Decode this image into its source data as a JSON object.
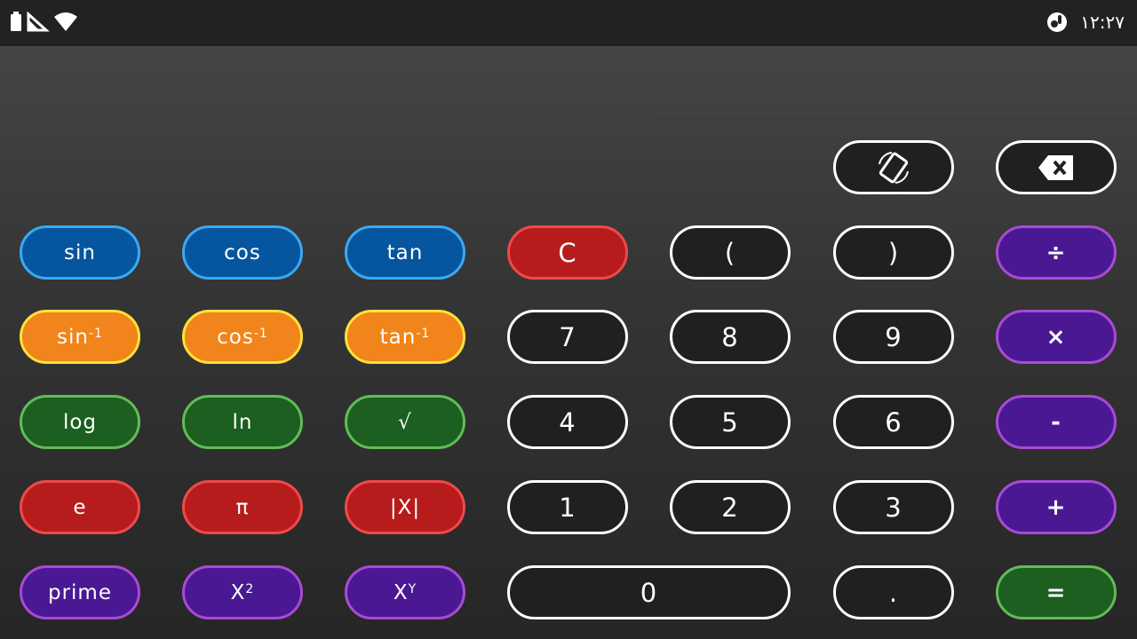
{
  "status_bar": {
    "time": "۱۲:۲۷",
    "icons": [
      "battery-icon",
      "signal-icon",
      "wifi-icon",
      "app-notification-icon"
    ]
  },
  "keys": {
    "rotate_icon": "screen-rotation-icon",
    "backspace_icon": "backspace-icon",
    "sin": "sin",
    "cos": "cos",
    "tan": "tan",
    "clear": "C",
    "paren_open": "(",
    "paren_close": ")",
    "divide": "÷",
    "asin_base": "sin",
    "acos_base": "cos",
    "atan_base": "tan",
    "inverse_exp": "-1",
    "seven": "7",
    "eight": "8",
    "nine": "9",
    "multiply": "×",
    "log": "log",
    "ln": "ln",
    "sqrt": "√",
    "four": "4",
    "five": "5",
    "six": "6",
    "minus": "-",
    "e": "e",
    "pi": "π",
    "abs": "|X|",
    "one": "1",
    "two": "2",
    "three": "3",
    "plus": "+",
    "prime": "prime",
    "square_base": "X",
    "square_exp": "2",
    "power_base": "X",
    "power_exp": "Y",
    "zero": "0",
    "dot": ".",
    "equals": "="
  },
  "colors": {
    "status_bar": "#222222",
    "trig": "#05559f",
    "inverse_trig": "#f1841a",
    "log_group": "#1c5f20",
    "const_group": "#b71c1c",
    "operator": "#4b1894",
    "digit": "#202020",
    "equals": "#1c5f20"
  }
}
